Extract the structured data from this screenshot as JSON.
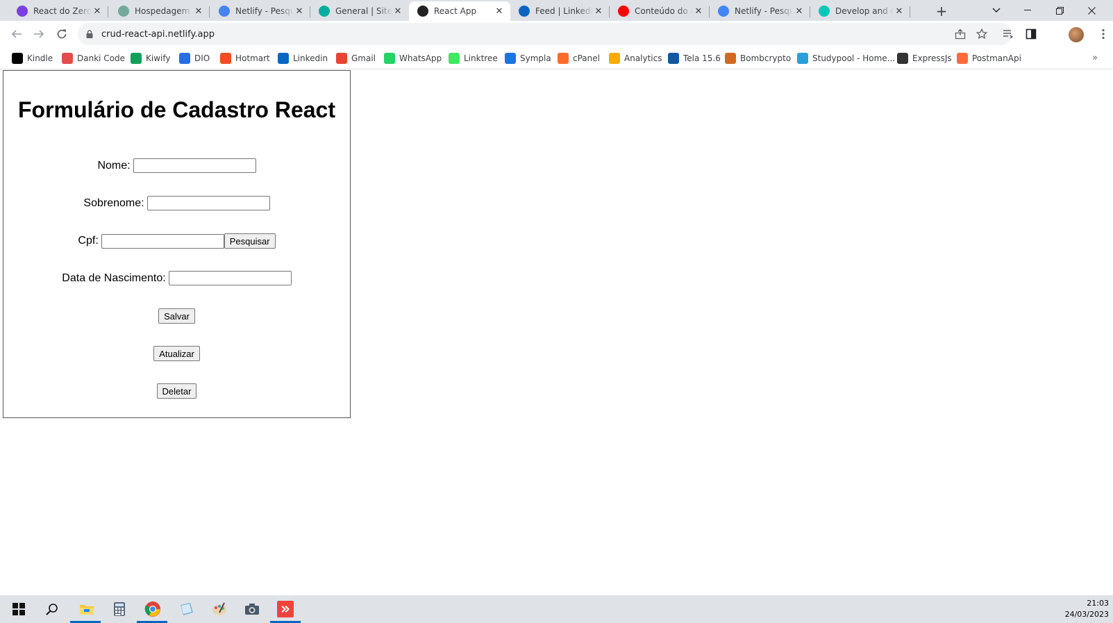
{
  "browser": {
    "tabs": [
      {
        "title": "React do Zero a",
        "favicon": "purple-circle-icon",
        "color": "#7b3fe4"
      },
      {
        "title": "Hospedagem e",
        "favicon": "openai-icon",
        "color": "#74aa9c"
      },
      {
        "title": "Netlify - Pesqu",
        "favicon": "google-g-icon",
        "color": "#4285f4"
      },
      {
        "title": "General | Site se",
        "favicon": "netlify-diamond-icon",
        "color": "#00ad9f"
      },
      {
        "title": "React App",
        "favicon": "react-icon",
        "color": "#222222",
        "active": true
      },
      {
        "title": "Feed | LinkedIn",
        "favicon": "linkedin-icon",
        "color": "#0a66c2"
      },
      {
        "title": "Conteúdo do c",
        "favicon": "youtube-icon",
        "color": "#ff0000"
      },
      {
        "title": "Netlify - Pesqu",
        "favicon": "google-g-icon",
        "color": "#4285f4"
      },
      {
        "title": "Develop and de",
        "favicon": "netlify-plus-icon",
        "color": "#00c7b7"
      }
    ],
    "url": "crud-react-api.netlify.app",
    "bookmarks": [
      {
        "label": "Kindle",
        "icon": "kindle-icon",
        "color": "#000000"
      },
      {
        "label": "Danki Code",
        "icon": "code-brackets-icon",
        "color": "#e34c4c"
      },
      {
        "label": "Kiwify",
        "icon": "kiwify-icon",
        "color": "#11a05a"
      },
      {
        "label": "DIO",
        "icon": "dio-icon",
        "color": "#2a6de0"
      },
      {
        "label": "Hotmart",
        "icon": "hotmart-flame-icon",
        "color": "#f04e23"
      },
      {
        "label": "Linkedin",
        "icon": "linkedin-icon",
        "color": "#0a66c2"
      },
      {
        "label": "Gmail",
        "icon": "gmail-icon",
        "color": "#ea4335"
      },
      {
        "label": "WhatsApp",
        "icon": "whatsapp-icon",
        "color": "#25d366"
      },
      {
        "label": "Linktree",
        "icon": "linktree-icon",
        "color": "#43e660"
      },
      {
        "label": "Sympla",
        "icon": "sympla-icon",
        "color": "#1a73e8"
      },
      {
        "label": "cPanel",
        "icon": "cpanel-icon",
        "color": "#ff6c2c"
      },
      {
        "label": "Analytics",
        "icon": "analytics-icon",
        "color": "#f9ab00"
      },
      {
        "label": "Tela 15.6",
        "icon": "ml-icon",
        "color": "#1457a8"
      },
      {
        "label": "Bombcrypto",
        "icon": "bombcrypto-icon",
        "color": "#d2691e"
      },
      {
        "label": "Studypool - Home...",
        "icon": "studypool-icon",
        "color": "#2aa0d8"
      },
      {
        "label": "ExpressJs",
        "icon": "express-icon",
        "color": "#333333"
      },
      {
        "label": "PostmanApi",
        "icon": "postman-icon",
        "color": "#ff6c37"
      }
    ]
  },
  "form": {
    "title": "Formulário de Cadastro React",
    "nome_label": "Nome:",
    "nome_value": "",
    "sobrenome_label": "Sobrenome:",
    "sobrenome_value": "",
    "cpf_label": "Cpf:",
    "cpf_value": "",
    "pesquisar_label": "Pesquisar",
    "nascimento_label": "Data de Nascimento:",
    "nascimento_value": "",
    "salvar_label": "Salvar",
    "atualizar_label": "Atualizar",
    "deletar_label": "Deletar"
  },
  "taskbar": {
    "icons": [
      "windows-start-icon",
      "search-icon",
      "file-explorer-icon",
      "calculator-icon",
      "chrome-icon",
      "notepad-icon",
      "paint-icon",
      "camera-icon",
      "anydesk-icon"
    ],
    "time": "21:03",
    "date": "24/03/2023"
  }
}
